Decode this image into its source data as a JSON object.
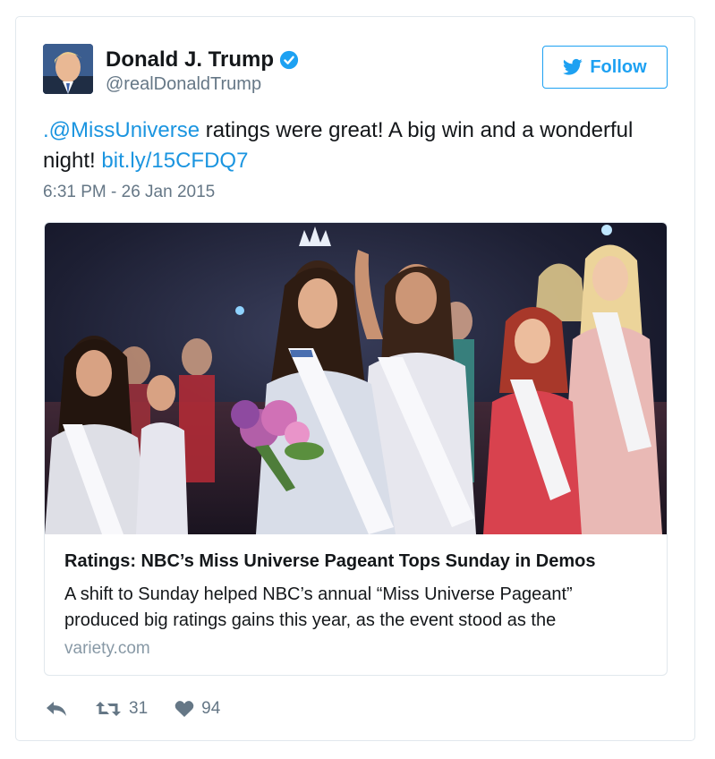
{
  "user": {
    "name": "Donald J. Trump",
    "handle": "@realDonaldTrump",
    "verified": true,
    "avatar_icon": "user-avatar"
  },
  "follow_button": {
    "label": "Follow",
    "icon": "twitter-bird-icon"
  },
  "tweet": {
    "mention": ".@MissUniverse",
    "text_part1": " ratings were great! A big win and a wonderful night! ",
    "link": "bit.ly/15CFDQ7",
    "timestamp": "6:31 PM - 26 Jan 2015"
  },
  "card": {
    "title": "Ratings: NBC’s Miss Universe Pageant Tops Sunday in Demos",
    "description": "A shift to Sunday helped NBC’s annual “Miss Universe Pageant” produced big ratings gains this year, as the event stood as the",
    "domain": "variety.com"
  },
  "actions": {
    "reply_icon": "reply-icon",
    "retweet_icon": "retweet-icon",
    "retweet_count": "31",
    "like_icon": "heart-icon",
    "like_count": "94"
  },
  "colors": {
    "link": "#1b95e0",
    "accent": "#1da1f2",
    "muted": "#657786"
  }
}
